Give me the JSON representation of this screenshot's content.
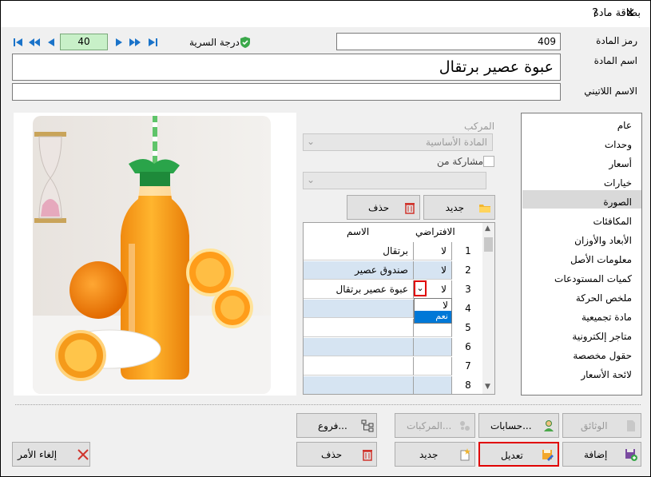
{
  "window": {
    "title": "بطاقة مادة",
    "help_label": "?",
    "close_label": "✕"
  },
  "header": {
    "code_label": "رمز المادة",
    "code_value": "409",
    "name_label": "اسم المادة",
    "name_value": "عبوة عصير برتقال",
    "latin_label": "الاسم اللاتيني",
    "latin_value": "",
    "record_number": "40",
    "confidentiality_label": "درجة السرية"
  },
  "sidebar": {
    "items": [
      {
        "label": "عام"
      },
      {
        "label": "وحدات"
      },
      {
        "label": "أسعار"
      },
      {
        "label": "خيارات"
      },
      {
        "label": "الصورة",
        "selected": true
      },
      {
        "label": "المكافئات"
      },
      {
        "label": "الأبعاد والأوزان"
      },
      {
        "label": "معلومات الأصل"
      },
      {
        "label": "كميات المستودعات"
      },
      {
        "label": "ملخص الحركة"
      },
      {
        "label": "مادة تجميعية"
      },
      {
        "label": "متاجر إلكترونية"
      },
      {
        "label": "حقول مخصصة"
      },
      {
        "label": "لائحة الأسعار"
      }
    ]
  },
  "image_panel": {
    "composite_label": "المركب",
    "base_material": "المادة الأساسية",
    "share_from_label": "مشاركة من",
    "new_button": "جديد",
    "delete_button": "حذف",
    "grid": {
      "col_default": "الافتراضي",
      "col_name": "الاسم",
      "rows": [
        {
          "num": "1",
          "default": "لا",
          "name": "برتقال"
        },
        {
          "num": "2",
          "default": "لا",
          "name": "صندوق عصير"
        },
        {
          "num": "3",
          "default": "لا",
          "name": "عبوة عصير برتقال"
        },
        {
          "num": "4",
          "default": "",
          "name": ""
        },
        {
          "num": "5",
          "default": "",
          "name": ""
        },
        {
          "num": "6",
          "default": "",
          "name": ""
        },
        {
          "num": "7",
          "default": "",
          "name": ""
        },
        {
          "num": "8",
          "default": "",
          "name": ""
        }
      ],
      "dropdown_options": [
        "لا",
        "نعم"
      ]
    }
  },
  "footer": {
    "documents": "الوثائق",
    "accounts": "حسابات...",
    "composites": "المركبات...",
    "branches": "فروع...",
    "add": "إضافة",
    "modify": "تعديل",
    "new": "جديد",
    "delete": "حذف",
    "cancel": "إلغاء الأمر"
  },
  "colors": {
    "highlight_border": "#e00000",
    "record_bg": "#c8f0c8",
    "grid_blue": "#d6e4f2",
    "selection": "#0078d7"
  }
}
